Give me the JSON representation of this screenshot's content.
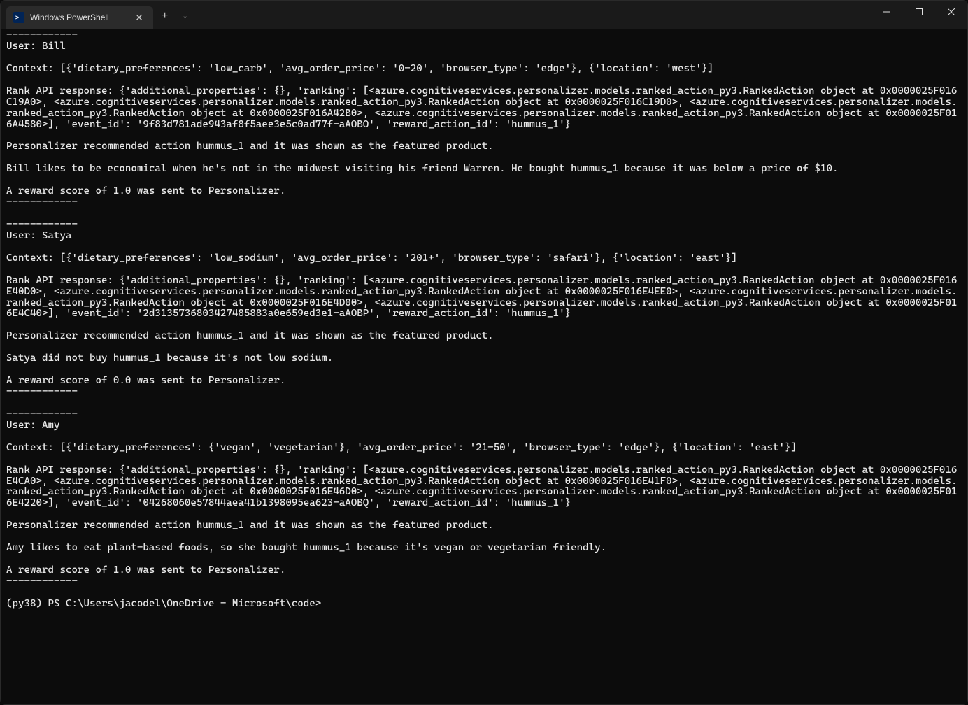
{
  "window": {
    "tab_title": "Windows PowerShell"
  },
  "terminal": {
    "separator_top": "------------",
    "user1_label": "User: Bill",
    "blank1": "",
    "user1_context": "Context: [{'dietary_preferences': 'low_carb', 'avg_order_price': '0-20', 'browser_type': 'edge'}, {'location': 'west'}]",
    "blank2": "",
    "user1_rank": "Rank API response: {'additional_properties': {}, 'ranking': [<azure.cognitiveservices.personalizer.models.ranked_action_py3.RankedAction object at 0x0000025F016C19A0>, <azure.cognitiveservices.personalizer.models.ranked_action_py3.RankedAction object at 0x0000025F016C19D0>, <azure.cognitiveservices.personalizer.models.ranked_action_py3.RankedAction object at 0x0000025F016A42B0>, <azure.cognitiveservices.personalizer.models.ranked_action_py3.RankedAction object at 0x0000025F016A4580>], 'event_id': '9f83d781ade943af8f5aee3e5c0ad77f-aAOBO', 'reward_action_id': 'hummus_1'}",
    "blank3": "",
    "user1_recommended": "Personalizer recommended action hummus_1 and it was shown as the featured product.",
    "blank4": "",
    "user1_story": "Bill likes to be economical when he's not in the midwest visiting his friend Warren. He bought hummus_1 because it was below a price of $10.",
    "blank5": "",
    "user1_reward": "A reward score of 1.0 was sent to Personalizer.",
    "user1_sep": "------------",
    "blank6": "",
    "sep2": "------------",
    "user2_label": "User: Satya",
    "blank7": "",
    "user2_context": "Context: [{'dietary_preferences': 'low_sodium', 'avg_order_price': '201+', 'browser_type': 'safari'}, {'location': 'east'}]",
    "blank8": "",
    "user2_rank": "Rank API response: {'additional_properties': {}, 'ranking': [<azure.cognitiveservices.personalizer.models.ranked_action_py3.RankedAction object at 0x0000025F016E40D0>, <azure.cognitiveservices.personalizer.models.ranked_action_py3.RankedAction object at 0x0000025F016E4EE0>, <azure.cognitiveservices.personalizer.models.ranked_action_py3.RankedAction object at 0x0000025F016E4D00>, <azure.cognitiveservices.personalizer.models.ranked_action_py3.RankedAction object at 0x0000025F016E4C40>], 'event_id': '2d3135736803427485883a0e659ed3e1-aAOBP', 'reward_action_id': 'hummus_1'}",
    "blank9": "",
    "user2_recommended": "Personalizer recommended action hummus_1 and it was shown as the featured product.",
    "blank10": "",
    "user2_story": "Satya did not buy hummus_1 because it's not low sodium.",
    "blank11": "",
    "user2_reward": "A reward score of 0.0 was sent to Personalizer.",
    "user2_sep": "------------",
    "blank12": "",
    "sep3": "------------",
    "user3_label": "User: Amy",
    "blank13": "",
    "user3_context": "Context: [{'dietary_preferences': {'vegan', 'vegetarian'}, 'avg_order_price': '21-50', 'browser_type': 'edge'}, {'location': 'east'}]",
    "blank14": "",
    "user3_rank": "Rank API response: {'additional_properties': {}, 'ranking': [<azure.cognitiveservices.personalizer.models.ranked_action_py3.RankedAction object at 0x0000025F016E4CA0>, <azure.cognitiveservices.personalizer.models.ranked_action_py3.RankedAction object at 0x0000025F016E41F0>, <azure.cognitiveservices.personalizer.models.ranked_action_py3.RankedAction object at 0x0000025F016E46D0>, <azure.cognitiveservices.personalizer.models.ranked_action_py3.RankedAction object at 0x0000025F016E4220>], 'event_id': '04268060e57844aea41b1398095ea623-aAOBQ', 'reward_action_id': 'hummus_1'}",
    "blank15": "",
    "user3_recommended": "Personalizer recommended action hummus_1 and it was shown as the featured product.",
    "blank16": "",
    "user3_story": "Amy likes to eat plant-based foods, so she bought hummus_1 because it's vegan or vegetarian friendly.",
    "blank17": "",
    "user3_reward": "A reward score of 1.0 was sent to Personalizer.",
    "user3_sep": "------------",
    "blank18": "",
    "prompt": "(py38) PS C:\\Users\\jacodel\\OneDrive - Microsoft\\code> "
  }
}
